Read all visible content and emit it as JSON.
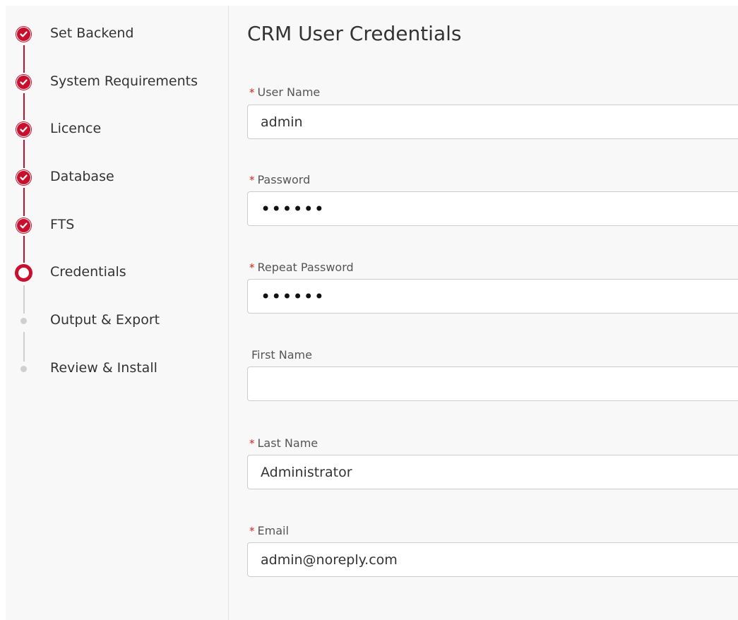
{
  "steps": [
    {
      "label": "Set Backend",
      "state": "done"
    },
    {
      "label": "System Requirements",
      "state": "done"
    },
    {
      "label": "Licence",
      "state": "done"
    },
    {
      "label": "Database",
      "state": "done"
    },
    {
      "label": "FTS",
      "state": "done"
    },
    {
      "label": "Credentials",
      "state": "current"
    },
    {
      "label": "Output & Export",
      "state": "todo"
    },
    {
      "label": "Review & Install",
      "state": "todo"
    }
  ],
  "form": {
    "title": "CRM User Credentials",
    "required_mark": "*",
    "fields": [
      {
        "label": "User Name",
        "required": true,
        "value": "admin"
      },
      {
        "label": "Password",
        "required": true,
        "value": "••••••"
      },
      {
        "label": "Repeat Password",
        "required": true,
        "value": "••••••"
      },
      {
        "label": "First Name",
        "required": false,
        "value": ""
      },
      {
        "label": "Last Name",
        "required": true,
        "value": "Administrator"
      },
      {
        "label": "Email",
        "required": true,
        "value": "admin@noreply.com"
      }
    ]
  },
  "colors": {
    "accent": "#c8102e",
    "pending": "#cfcfcf",
    "required": "#d4261f",
    "background": "#f8f8f8"
  }
}
